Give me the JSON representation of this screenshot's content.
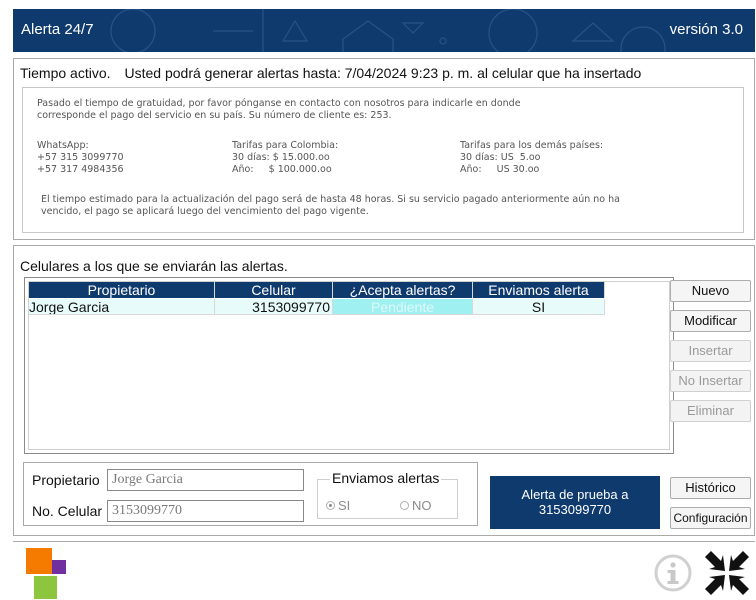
{
  "app": {
    "title": "Alerta 24/7",
    "version": "versión 3.0"
  },
  "colors": {
    "brand": "#0f3a6e",
    "grid_row": "#e8fbfb",
    "accept_cell": "#9ff1f1",
    "logo_orange": "#f57a00",
    "logo_purple": "#7030a0",
    "logo_green": "#8cc63f"
  },
  "status": {
    "label": "Tiempo activo.",
    "message": "Usted podrá generar alertas hasta: 7/04/2024 9:23 p. m. al celular que ha insertado"
  },
  "info": {
    "intro_line1": "Pasado el tiempo de gratuidad, por favor pónganse en contacto con nosotros para indicarle en donde",
    "intro_line2": "corresponde el pago del servicio en su país.  Su número de cliente es: 253.",
    "whatsapp_label": "WhatsApp:",
    "whatsapp_1": "+57 315 3099770",
    "whatsapp_2": "+57 317 4984356",
    "colombia_label": "Tarifas para Colombia:",
    "colombia_30": "30 días: $  15.000.oo",
    "colombia_year": "Año:     $ 100.000.oo",
    "other_label": "Tarifas para los demás países:",
    "other_30": "30 días: US  5.oo",
    "other_year": "Año:     US 30.oo",
    "footer_line1": "El tiempo estimado para la actualización del pago será de hasta 48 horas.  Si su servicio pagado anteriormente aún no ha",
    "footer_line2": "vencido, el pago se aplicará luego del vencimiento del pago vigente."
  },
  "phones": {
    "section_title": "Celulares a los que se enviarán las alertas.",
    "columns": [
      "Propietario",
      "Celular",
      "¿Acepta alertas?",
      "Enviamos alerta"
    ],
    "rows": [
      {
        "owner": "Jorge Garcia",
        "phone": "3153099770",
        "accepts": "Pendiente",
        "send": "SI"
      }
    ]
  },
  "buttons": {
    "new": "Nuevo",
    "edit": "Modificar",
    "insert": "Insertar",
    "no_insert": "No Insertar",
    "delete": "Eliminar",
    "history": "Histórico",
    "settings": "Configuración",
    "test_alert_line1": "Alerta de prueba a",
    "test_alert_line2": "3153099770"
  },
  "form": {
    "owner_label": "Propietario",
    "owner_value": "Jorge Garcia",
    "phone_label": "No. Celular",
    "phone_value": "3153099770",
    "send_group_label": "Enviamos alertas",
    "option_yes": "SI",
    "option_no": "NO",
    "selected": "SI"
  },
  "icons": {
    "info": "info-icon",
    "collapse": "collapse-arrows-icon"
  }
}
